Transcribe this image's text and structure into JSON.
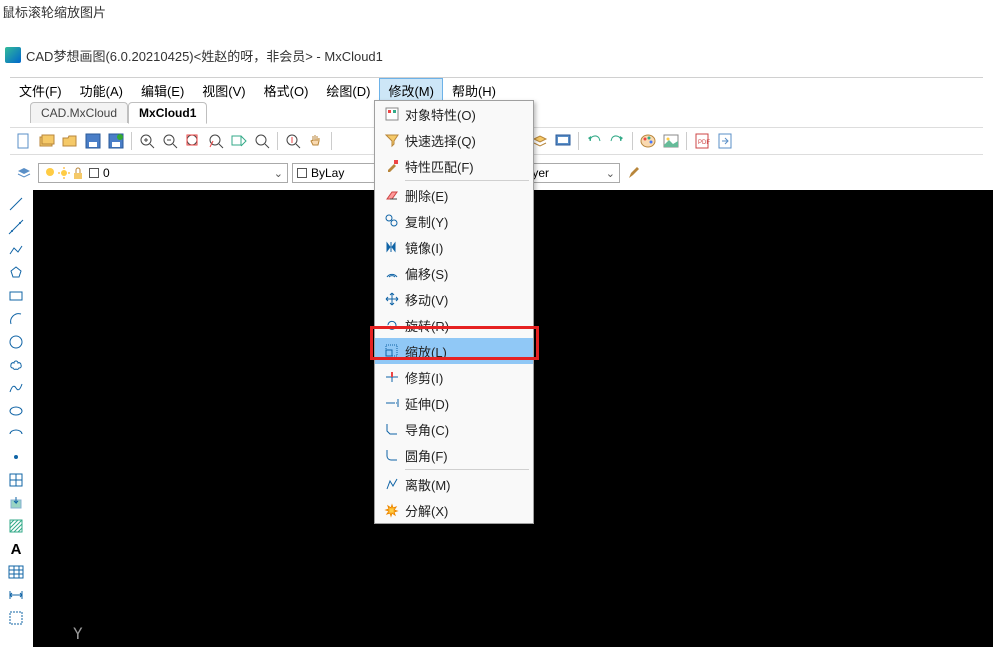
{
  "context_caption": "鼠标滚轮缩放图片",
  "window_title": "CAD梦想画图(6.0.20210425)<姓赵的呀，非会员> - MxCloud1",
  "menus": {
    "file": "文件(F)",
    "function": "功能(A)",
    "edit": "编辑(E)",
    "view": "视图(V)",
    "format": "格式(O)",
    "draw": "绘图(D)",
    "modify": "修改(M)",
    "help": "帮助(H)"
  },
  "tabs": {
    "inactive": "CAD.MxCloud",
    "active": "MxCloud1"
  },
  "layer_value": "0",
  "prop1": "ByLay",
  "prop2": "ByLayer",
  "modify_menu": {
    "props": "对象特性(O)",
    "quicksel": "快速选择(Q)",
    "matchprop": "特性匹配(F)",
    "delete": "删除(E)",
    "copy": "复制(Y)",
    "mirror": "镜像(I)",
    "offset": "偏移(S)",
    "move": "移动(V)",
    "rotate": "旋转(R)",
    "scale": "缩放(L)",
    "trim": "修剪(I)",
    "extend": "延伸(D)",
    "chamfer": "导角(C)",
    "fillet": "圆角(F)",
    "explode_m": "离散(M)",
    "explode_x": "分解(X)"
  },
  "coord_y": "Y"
}
